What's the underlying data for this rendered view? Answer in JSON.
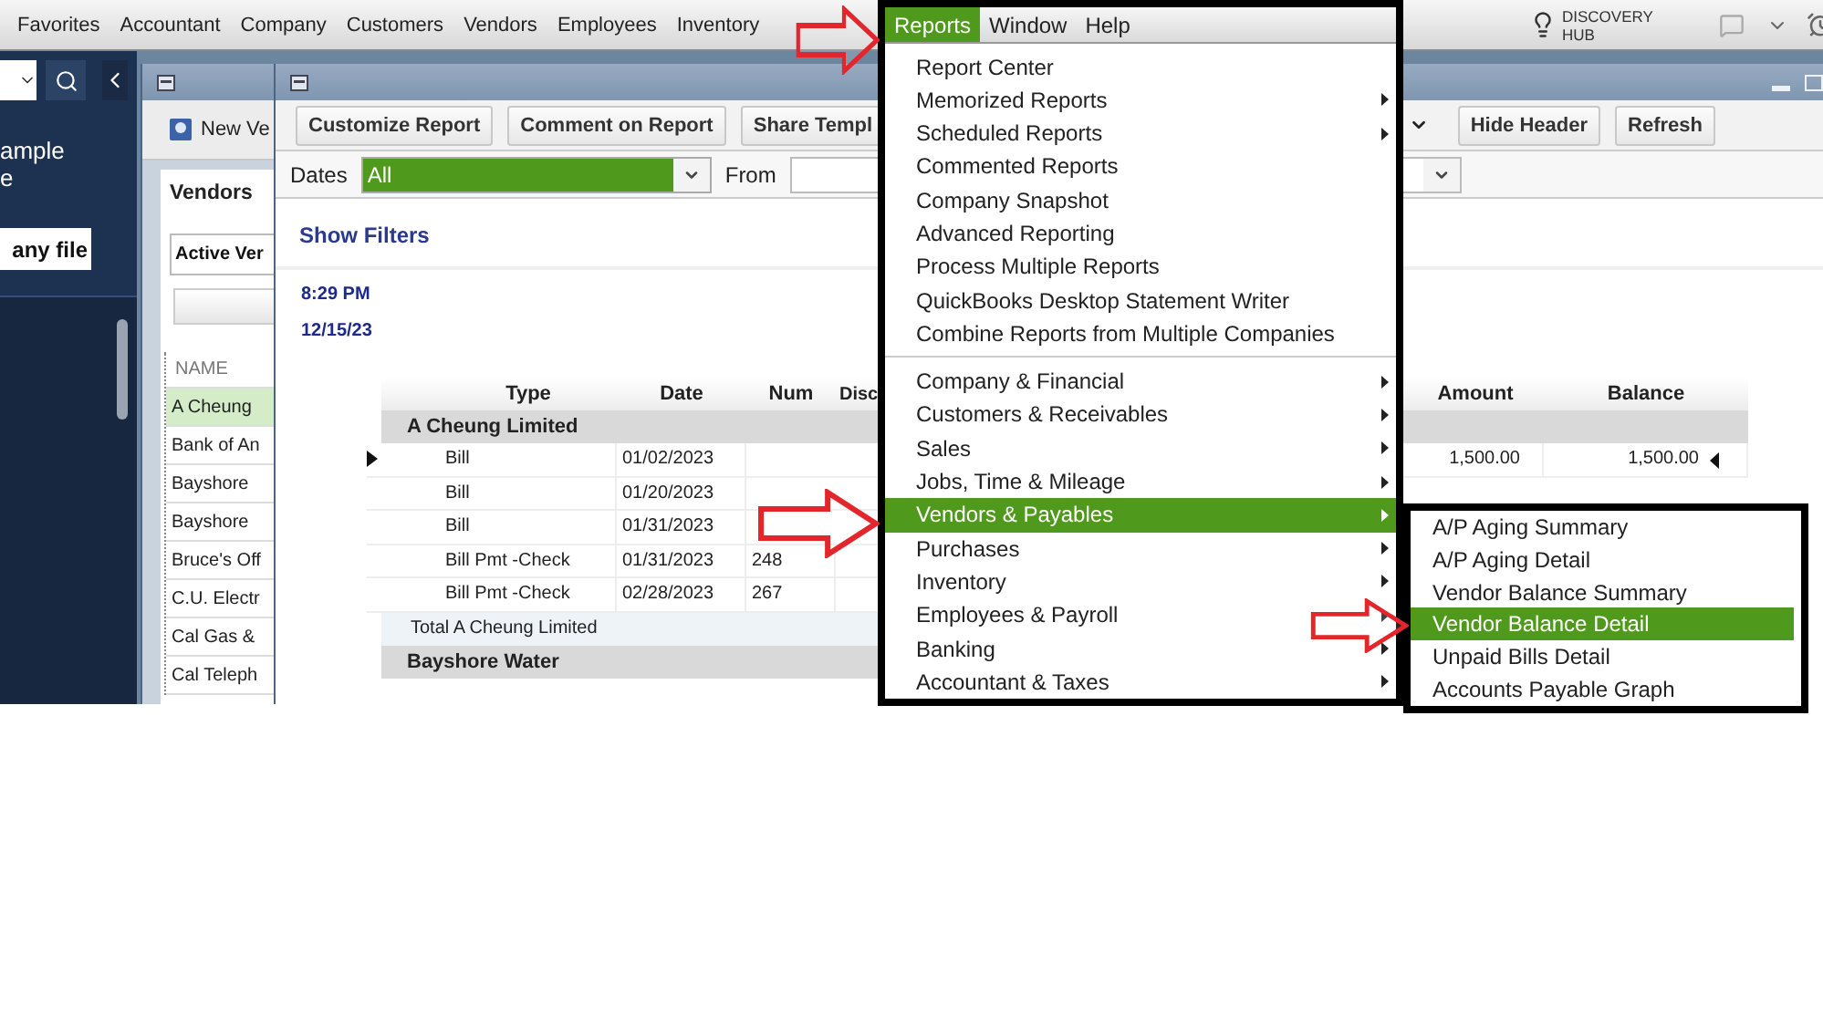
{
  "menu_bar": {
    "items": [
      "Favorites",
      "Accountant",
      "Company",
      "Customers",
      "Vendors",
      "Employees",
      "Inventory"
    ],
    "discovery_hub": "DISCOVERY HUB"
  },
  "sidebar": {
    "company_lines": [
      "ample",
      "e"
    ],
    "open_button": "any file"
  },
  "vendor_center": {
    "new_button": "New Ve",
    "tab": "Vendors",
    "filter": "Active Ver",
    "list_header": "NAME",
    "vendors": [
      {
        "name": "A Cheung",
        "selected": true
      },
      {
        "name": "Bank of An",
        "selected": false
      },
      {
        "name": "Bayshore",
        "selected": false
      },
      {
        "name": "Bayshore",
        "selected": false
      },
      {
        "name": "Bruce's Off",
        "selected": false
      },
      {
        "name": "C.U. Electr",
        "selected": false
      },
      {
        "name": "Cal Gas &",
        "selected": false
      },
      {
        "name": "Cal Teleph",
        "selected": false
      }
    ]
  },
  "report": {
    "toolbar": [
      "Customize Report",
      "Comment on Report",
      "Share Templ"
    ],
    "toolbar_right": [
      "Hide Header",
      "Refresh"
    ],
    "dates_label": "Dates",
    "dates_value": "All",
    "from_label": "From",
    "show_filters": "Show Filters",
    "time": "8:29 PM",
    "date": "12/15/23",
    "columns": [
      "Type",
      "Date",
      "Num",
      "Disc",
      "Amount",
      "Balance"
    ],
    "rows": [
      {
        "kind": "group",
        "label": "A Cheung Limited"
      },
      {
        "kind": "line",
        "type": "Bill",
        "date": "01/02/2023",
        "num": "",
        "amount": "1,500.00",
        "balance": "1,500.00",
        "current": true
      },
      {
        "kind": "line",
        "type": "Bill",
        "date": "01/20/2023",
        "num": "",
        "current": false
      },
      {
        "kind": "line",
        "type": "Bill",
        "date": "01/31/2023",
        "num": "",
        "current": false
      },
      {
        "kind": "line",
        "type": "Bill Pmt -Check",
        "date": "01/31/2023",
        "num": "248",
        "current": false
      },
      {
        "kind": "line",
        "type": "Bill Pmt -Check",
        "date": "02/28/2023",
        "num": "267",
        "current": false
      },
      {
        "kind": "total",
        "label": "Total A Cheung Limited"
      },
      {
        "kind": "group",
        "label": "Bayshore Water"
      }
    ]
  },
  "open_menu": {
    "bar": [
      {
        "label": "Reports",
        "selected": true
      },
      {
        "label": "Window",
        "selected": false
      },
      {
        "label": "Help",
        "selected": false
      }
    ],
    "groups": [
      [
        {
          "label": "Report Center",
          "submenu": false,
          "selected": false
        },
        {
          "label": "Memorized Reports",
          "submenu": true,
          "selected": false
        },
        {
          "label": "Scheduled Reports",
          "submenu": true,
          "selected": false
        },
        {
          "label": "Commented Reports",
          "submenu": false,
          "selected": false
        },
        {
          "label": "Company Snapshot",
          "submenu": false,
          "selected": false
        },
        {
          "label": "Advanced Reporting",
          "submenu": false,
          "selected": false
        },
        {
          "label": "Process Multiple Reports",
          "submenu": false,
          "selected": false
        },
        {
          "label": "QuickBooks Desktop Statement Writer",
          "submenu": false,
          "selected": false
        },
        {
          "label": "Combine Reports from Multiple Companies",
          "submenu": false,
          "selected": false
        }
      ],
      [
        {
          "label": "Company & Financial",
          "submenu": true,
          "selected": false
        },
        {
          "label": "Customers & Receivables",
          "submenu": true,
          "selected": false
        },
        {
          "label": "Sales",
          "submenu": true,
          "selected": false
        },
        {
          "label": "Jobs, Time & Mileage",
          "submenu": true,
          "selected": false
        },
        {
          "label": "Vendors & Payables",
          "submenu": true,
          "selected": true
        },
        {
          "label": "Purchases",
          "submenu": true,
          "selected": false
        },
        {
          "label": "Inventory",
          "submenu": true,
          "selected": false
        },
        {
          "label": "Employees & Payroll",
          "submenu": true,
          "selected": false
        },
        {
          "label": "Banking",
          "submenu": true,
          "selected": false
        },
        {
          "label": "Accountant & Taxes",
          "submenu": true,
          "selected": false
        }
      ]
    ]
  },
  "submenu": {
    "items": [
      {
        "label": "A/P Aging Summary",
        "selected": false
      },
      {
        "label": "A/P Aging Detail",
        "selected": false
      },
      {
        "label": "Vendor Balance Summary",
        "selected": false
      },
      {
        "label": "Vendor Balance Detail",
        "selected": true
      },
      {
        "label": "Unpaid Bills Detail",
        "selected": false
      },
      {
        "label": "Accounts Payable Graph",
        "selected": false
      }
    ]
  }
}
